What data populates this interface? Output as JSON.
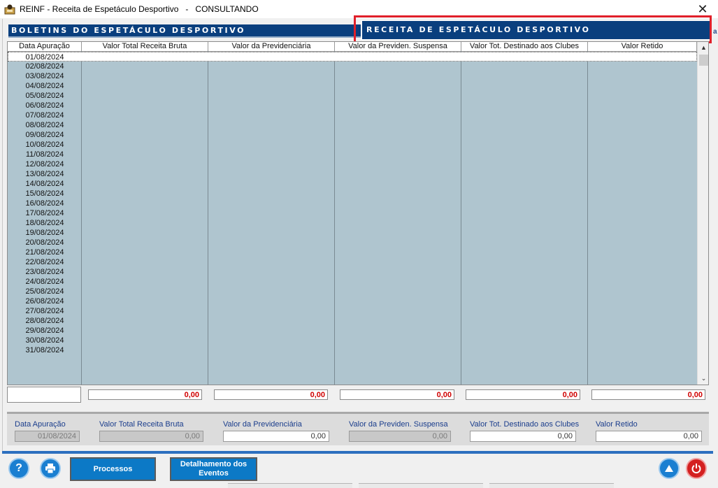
{
  "window": {
    "title": "REINF - Receita de Espetáculo Desportivo   -   CONSULTANDO",
    "close_glyph": "✕"
  },
  "headers": {
    "left": "BOLETINS DO ESPETÁCULO DESPORTIVO",
    "right": "RECEITA DE ESPETÁCULO DESPORTIVO",
    "edge_letter": "a"
  },
  "grid": {
    "columns": [
      "Data Apuração",
      "Valor Total Receita Bruta",
      "Valor da Previdenciária",
      "Valor da Previden. Suspensa",
      "Valor Tot. Destinado aos Clubes",
      "Valor Retido"
    ],
    "rows": [
      "01/08/2024",
      "02/08/2024",
      "03/08/2024",
      "04/08/2024",
      "05/08/2024",
      "06/08/2024",
      "07/08/2024",
      "08/08/2024",
      "09/08/2024",
      "10/08/2024",
      "11/08/2024",
      "12/08/2024",
      "13/08/2024",
      "14/08/2024",
      "15/08/2024",
      "16/08/2024",
      "17/08/2024",
      "18/08/2024",
      "19/08/2024",
      "20/08/2024",
      "21/08/2024",
      "22/08/2024",
      "23/08/2024",
      "24/08/2024",
      "25/08/2024",
      "26/08/2024",
      "27/08/2024",
      "28/08/2024",
      "29/08/2024",
      "30/08/2024",
      "31/08/2024"
    ],
    "totals": [
      "0,00",
      "0,00",
      "0,00",
      "0,00",
      "0,00"
    ]
  },
  "detail": {
    "labels": [
      "Data Apuração",
      "Valor Total Receita Bruta",
      "Valor da Previdenciária",
      "Valor da Previden. Suspensa",
      "Valor Tot. Destinado aos Clubes",
      "Valor Retido"
    ],
    "values": [
      "01/08/2024",
      "0,00",
      "0,00",
      "0,00",
      "0,00",
      "0,00"
    ]
  },
  "toolbar": {
    "help_glyph": "?",
    "processos_label": "Processos",
    "detalhamento_label": "Detalhamento dos Eventos"
  },
  "colors": {
    "header_blue": "#0a3f7e",
    "grid_bg": "#afc5cf",
    "button_blue": "#0c79c6",
    "total_red": "#d00000",
    "highlight_red": "#e0202a"
  }
}
